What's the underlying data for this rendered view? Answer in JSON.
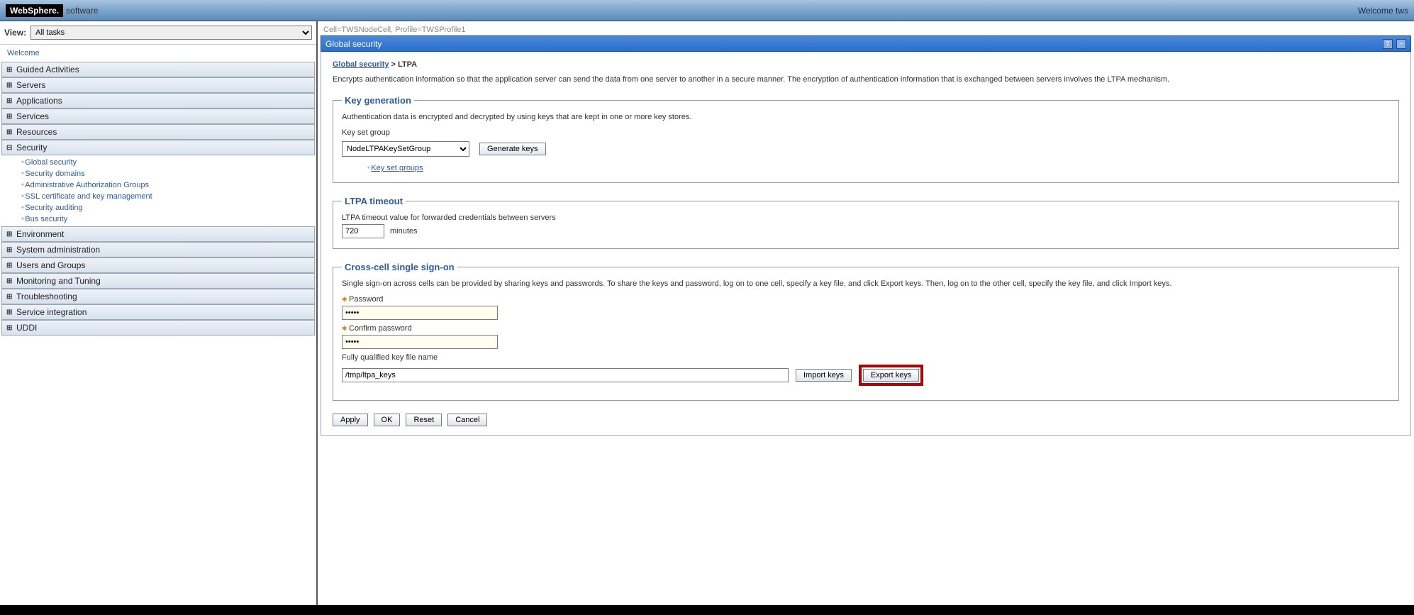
{
  "banner": {
    "logo_main": "WebSphere.",
    "logo_sub": "software",
    "welcome": "Welcome tws"
  },
  "left": {
    "view_label": "View:",
    "view_selected": "All tasks",
    "welcome": "Welcome",
    "sections": [
      {
        "label": "Guided Activities",
        "expanded": false
      },
      {
        "label": "Servers",
        "expanded": false
      },
      {
        "label": "Applications",
        "expanded": false
      },
      {
        "label": "Services",
        "expanded": false
      },
      {
        "label": "Resources",
        "expanded": false
      },
      {
        "label": "Security",
        "expanded": true,
        "subs": [
          "Global security",
          "Security domains",
          "Administrative Authorization Groups",
          "SSL certificate and key management",
          "Security auditing",
          "Bus security"
        ]
      },
      {
        "label": "Environment",
        "expanded": false
      },
      {
        "label": "System administration",
        "expanded": false
      },
      {
        "label": "Users and Groups",
        "expanded": false
      },
      {
        "label": "Monitoring and Tuning",
        "expanded": false
      },
      {
        "label": "Troubleshooting",
        "expanded": false
      },
      {
        "label": "Service integration",
        "expanded": false
      },
      {
        "label": "UDDI",
        "expanded": false
      }
    ]
  },
  "right": {
    "cell_info": "Cell=TWSNodeCell, Profile=TWSProfile1",
    "page_title": "Global security",
    "breadcrumb": {
      "link": "Global security",
      "current": "LTPA"
    },
    "description": "Encrypts authentication information so that the application server can send the data from one server to another in a secure manner. The encryption of authentication information that is exchanged between servers involves the LTPA mechanism.",
    "keygen": {
      "legend": "Key generation",
      "text": "Authentication data is encrypted and decrypted by using keys that are kept in one or more key stores.",
      "ksg_label": "Key set group",
      "ksg_value": "NodeLTPAKeySetGroup",
      "gen_btn": "Generate keys",
      "ksg_link": "Key set groups"
    },
    "timeout": {
      "legend": "LTPA timeout",
      "label": "LTPA timeout value for forwarded credentials between servers",
      "value": "720",
      "unit": "minutes"
    },
    "sso": {
      "legend": "Cross-cell single sign-on",
      "text": "Single sign-on across cells can be provided by sharing keys and passwords. To share the keys and password, log on to one cell, specify a key file, and click Export keys. Then, log on to the other cell, specify the key file, and click Import keys.",
      "password_label": "Password",
      "password_value": "•••••",
      "confirm_label": "Confirm password",
      "confirm_value": "•••••",
      "keyfile_label": "Fully qualified key file name",
      "keyfile_value": "/tmp/ltpa_keys",
      "import_btn": "Import keys",
      "export_btn": "Export keys"
    },
    "buttons": {
      "apply": "Apply",
      "ok": "OK",
      "reset": "Reset",
      "cancel": "Cancel"
    }
  }
}
